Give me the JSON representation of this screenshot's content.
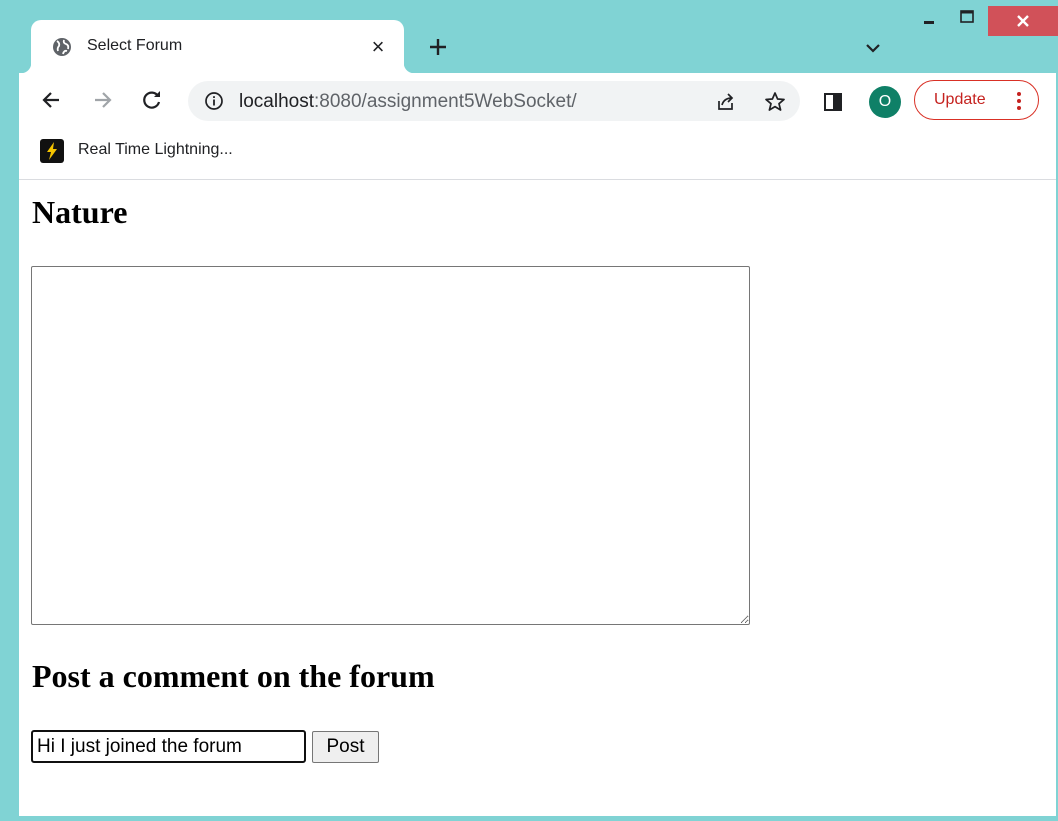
{
  "browser": {
    "tab": {
      "title": "Select Forum",
      "close_glyph": "×",
      "favicon": "globe-icon"
    },
    "new_tab_icon": "plus-icon",
    "tab_search_icon": "chevron-down-icon",
    "window_controls": [
      "minimize-icon",
      "maximize-icon",
      "close-icon"
    ],
    "address": {
      "host": "localhost",
      "rest": ":8080/assignment5WebSocket/"
    },
    "profile_initial": "O",
    "update_label": "Update",
    "bookmark_label": "Real Time Lightning...",
    "colors": {
      "frame": "#80d3d4",
      "avatar": "#0f8067",
      "update": "#c5221f",
      "close_button": "#d15159"
    }
  },
  "page": {
    "forum_title": "Nature",
    "messages_value": "",
    "post_heading": "Post a comment on the forum",
    "comment_value": "Hi I just joined the forum",
    "post_button_label": "Post"
  }
}
